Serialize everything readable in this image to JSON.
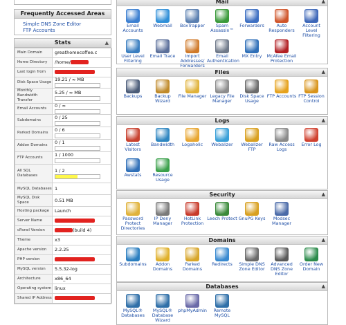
{
  "left": {
    "top_box_text": "",
    "frequent": {
      "title": "Frequently Accessed Areas",
      "links": [
        "Simple DNS Zone Editor",
        "FTP Accounts"
      ]
    },
    "stats": {
      "title": "Stats",
      "rows": [
        {
          "label": "Main Domain",
          "value": "greathomecoffee.c"
        },
        {
          "label": "Home Directory",
          "value": "/home/",
          "redact": true
        },
        {
          "label": "Last login from",
          "value": "",
          "redact": true
        },
        {
          "label": "Disk Space Usage",
          "value": "19.21 / ∞ MB",
          "bar": 0.0
        },
        {
          "label": "Monthly Bandwidth Transfer",
          "value": "5.25 / ∞ MB",
          "bar": 0.0
        },
        {
          "label": "Email Accounts",
          "value": "0 / ∞",
          "bar": 0.0
        },
        {
          "label": "Subdomains",
          "value": "0 / 25",
          "bar": 0.0
        },
        {
          "label": "Parked Domains",
          "value": "0 / 6",
          "bar": 0.0
        },
        {
          "label": "Addon Domains",
          "value": "0 / 1",
          "bar": 0.0
        },
        {
          "label": "FTP Accounts",
          "value": "1 / 1000",
          "bar": 0.0
        },
        {
          "label": "All SQL Databases",
          "value": "1 / 2",
          "bar": 0.5
        },
        {
          "label": "MySQL Databases",
          "value": "1"
        },
        {
          "label": "MySQL Disk Space",
          "value": "0.51 MB"
        },
        {
          "label": "Hosting package",
          "value": "Launch"
        },
        {
          "label": "Server Name",
          "value": "",
          "redact": true
        },
        {
          "label": "cPanel Version",
          "value": "(build 4)",
          "redact": true
        },
        {
          "label": "Theme",
          "value": "x3"
        },
        {
          "label": "Apache version",
          "value": "2.2.25"
        },
        {
          "label": "PHP version",
          "value": "",
          "redact": true
        },
        {
          "label": "MySQL version",
          "value": "5.5.32-log"
        },
        {
          "label": "Architecture",
          "value": "x86_64"
        },
        {
          "label": "Operating system",
          "value": "linux"
        },
        {
          "label": "Shared IP Address",
          "value": "",
          "redact": true
        }
      ]
    }
  },
  "sections": [
    {
      "title": "Mail",
      "items": [
        {
          "label": "Email Accounts",
          "icon": "email-accounts-icon",
          "color": "#3b7fd1"
        },
        {
          "label": "Webmail",
          "icon": "webmail-icon",
          "color": "#2f8fd8"
        },
        {
          "label": "BoxTrapper",
          "icon": "boxtrapper-icon",
          "color": "#5a7fb0"
        },
        {
          "label": "Spam Assassin™",
          "icon": "spam-assassin-icon",
          "color": "#3a9a3a"
        },
        {
          "label": "Forwarders",
          "icon": "forwarders-icon",
          "color": "#3d6fc2"
        },
        {
          "label": "Auto Responders",
          "icon": "auto-responders-icon",
          "color": "#d0552a"
        },
        {
          "label": "Account Level Filtering",
          "icon": "account-filter-icon",
          "color": "#3c66b8"
        },
        {
          "label": "User Level Filtering",
          "icon": "user-filter-icon",
          "color": "#3a7ec0"
        },
        {
          "label": "Email Trace",
          "icon": "email-trace-icon",
          "color": "#5b6f9a"
        },
        {
          "label": "Import Addresses/ Forwarders",
          "icon": "import-icon",
          "color": "#d07a2a"
        },
        {
          "label": "Email Authentication",
          "icon": "email-auth-icon",
          "color": "#707a8a"
        },
        {
          "label": "MX Entry",
          "icon": "mx-entry-icon",
          "color": "#2f6fb8"
        },
        {
          "label": "McAfee Email Protection",
          "icon": "mcafee-icon",
          "color": "#b21f24"
        }
      ]
    },
    {
      "title": "Files",
      "items": [
        {
          "label": "Backups",
          "icon": "backups-icon",
          "color": "#4a5b78"
        },
        {
          "label": "Backup Wizard",
          "icon": "backup-wizard-icon",
          "color": "#c08a2a"
        },
        {
          "label": "File Manager",
          "icon": "file-manager-icon",
          "color": "#e0b23a"
        },
        {
          "label": "Legacy File Manager",
          "icon": "legacy-file-manager-icon",
          "color": "#8c8c8c"
        },
        {
          "label": "Disk Space Usage",
          "icon": "disk-usage-icon",
          "color": "#6a6a6a"
        },
        {
          "label": "FTP Accounts",
          "icon": "ftp-accounts-icon",
          "color": "#e6a21c"
        },
        {
          "label": "FTP Session Control",
          "icon": "ftp-session-icon",
          "color": "#d9941a"
        }
      ]
    },
    {
      "title": "Logs",
      "items": [
        {
          "label": "Latest Visitors",
          "icon": "latest-visitors-icon",
          "color": "#c8402e"
        },
        {
          "label": "Bandwidth",
          "icon": "bandwidth-icon",
          "color": "#2e86c1"
        },
        {
          "label": "Logaholic",
          "icon": "logaholic-icon",
          "color": "#e8a630"
        },
        {
          "label": "Webalizer",
          "icon": "webalizer-icon",
          "color": "#3aa0d8"
        },
        {
          "label": "Webalizer FTP",
          "icon": "webalizer-ftp-icon",
          "color": "#d9a020"
        },
        {
          "label": "Raw Access Logs",
          "icon": "raw-logs-icon",
          "color": "#8a8a8a"
        },
        {
          "label": "Error Log",
          "icon": "error-log-icon",
          "color": "#d0402e"
        },
        {
          "label": "Awstats",
          "icon": "awstats-icon",
          "color": "#2f6fb8"
        },
        {
          "label": "Resource Usage",
          "icon": "resource-usage-icon",
          "color": "#3aa04a"
        }
      ]
    },
    {
      "title": "Security",
      "items": [
        {
          "label": "Password Protect Directories",
          "icon": "password-protect-icon",
          "color": "#e0b23a"
        },
        {
          "label": "IP Deny Manager",
          "icon": "ip-deny-icon",
          "color": "#7a7a7a"
        },
        {
          "label": "HotLink Protection",
          "icon": "hotlink-icon",
          "color": "#c83a2a"
        },
        {
          "label": "Leech Protect",
          "icon": "leech-protect-icon",
          "color": "#3a8a3a"
        },
        {
          "label": "GnuPG Keys",
          "icon": "gnupg-icon",
          "color": "#d8a020"
        },
        {
          "label": "Modsec Manager",
          "icon": "modsec-icon",
          "color": "#4a6aa8"
        }
      ]
    },
    {
      "title": "Domains",
      "items": [
        {
          "label": "Subdomains",
          "icon": "subdomains-icon",
          "color": "#2a7ec0"
        },
        {
          "label": "Addon Domains",
          "icon": "addon-domains-icon",
          "color": "#e0b02a"
        },
        {
          "label": "Parked Domains",
          "icon": "parked-domains-icon",
          "color": "#d8a62a"
        },
        {
          "label": "Redirects",
          "icon": "redirects-icon",
          "color": "#3a8ad0"
        },
        {
          "label": "Simple DNS Zone Editor",
          "icon": "simple-dns-icon",
          "color": "#6a6a6a"
        },
        {
          "label": "Advanced DNS Zone Editor",
          "icon": "advanced-dns-icon",
          "color": "#5a5a5a"
        },
        {
          "label": "Order New Domain",
          "icon": "order-domain-icon",
          "color": "#2a8a4a"
        }
      ]
    },
    {
      "title": "Databases",
      "items": [
        {
          "label": "MySQL® Databases",
          "icon": "mysql-databases-icon",
          "color": "#2f6fa8"
        },
        {
          "label": "MySQL® Database Wizard",
          "icon": "mysql-wizard-icon",
          "color": "#2f6fa8"
        },
        {
          "label": "phpMyAdmin",
          "icon": "phpmyadmin-icon",
          "color": "#6a6aa8"
        },
        {
          "label": "Remote MySQL",
          "icon": "remote-mysql-icon",
          "color": "#2f6fa8"
        }
      ]
    }
  ]
}
